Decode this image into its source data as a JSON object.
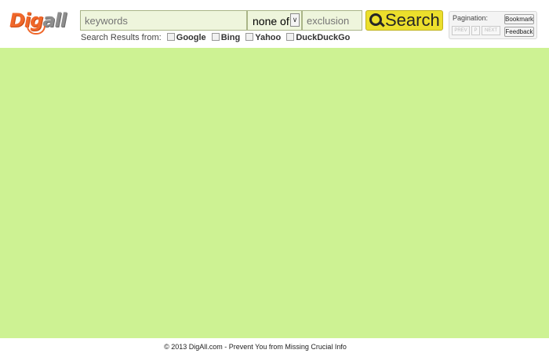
{
  "brand": {
    "logo_part1": "Dig",
    "logo_part2": "all",
    "orange": "#f0672a",
    "gray": "#8d8d8d"
  },
  "search": {
    "keywords_placeholder": "keywords",
    "mode_value": "none of",
    "exclusion_placeholder": "exclusion",
    "button_label": "Search",
    "button_color": "#ecdf2c"
  },
  "sources": {
    "label": "Search Results from:",
    "items": [
      {
        "label": "Google",
        "checked": false,
        "icon": "checkbox"
      },
      {
        "label": "Bing",
        "checked": false,
        "icon": "checkbox"
      },
      {
        "label": "Yahoo",
        "checked": false,
        "icon": "checkbox"
      },
      {
        "label": "DuckDuckGo",
        "checked": false,
        "icon": "checkbox"
      }
    ]
  },
  "pagination": {
    "title": "Pagination:",
    "prev": "PREV",
    "page": "P",
    "next": "NEXT",
    "bookmark": "Bookmark",
    "feedback": "Feedback"
  },
  "content": {
    "background": "#cdf293"
  },
  "footer": {
    "text": "© 2013 DigAll.com - Prevent You from Missing Crucial Info"
  }
}
